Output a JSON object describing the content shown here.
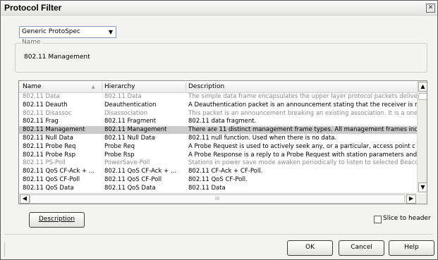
{
  "window": {
    "title": "Protocol Filter"
  },
  "protospec": {
    "selected": "Generic ProtoSpec"
  },
  "name_group": {
    "legend": "Name",
    "value": "802.11 Management"
  },
  "table": {
    "columns": [
      "Name",
      "Hierarchy",
      "Description"
    ],
    "rows": [
      {
        "name": "802.11 Data",
        "hierarchy": "802.11 Data",
        "description": "The simple data frame encapsulates the upper layer protocol packets delivere",
        "dim": true
      },
      {
        "name": "802.11 Deauth",
        "hierarchy": "Deauthentication",
        "description": "A Deauthentication packet is an announcement stating that the receiver is n",
        "dim": false
      },
      {
        "name": "802.11 Disassoc",
        "hierarchy": "Disassociation",
        "description": "This packet is an announcement breaking an existing association. It is a one",
        "dim": true
      },
      {
        "name": "802.11 Frag",
        "hierarchy": "802.11 Fragment",
        "description": "802.11 data fragment.",
        "dim": false
      },
      {
        "name": "802.11 Management",
        "hierarchy": "802.11 Management",
        "description": "There are 11 distinct management frame types. All management frames incl",
        "dim": false,
        "selected": true
      },
      {
        "name": "802.11 Null Data",
        "hierarchy": "802.11 Null Data",
        "description": "802.11 null function. Used when there is no data.",
        "dim": false
      },
      {
        "name": "802.11 Probe Req",
        "hierarchy": "Probe Req",
        "description": "A Probe Request is used to actively seek any, or a particular, access point c",
        "dim": false
      },
      {
        "name": "802.11 Probe Rsp",
        "hierarchy": "Probe Rsp",
        "description": "A Probe Response is a reply to a Probe Request with station parameters and",
        "dim": false
      },
      {
        "name": "802.11 PS-Poll",
        "hierarchy": "PowerSave-Poll",
        "description": "Stations in power save mode awaken periodically to listen to selected Beaco",
        "dim": true
      },
      {
        "name": "802.11 QoS CF-Ack + ...",
        "hierarchy": "802.11 QoS CF-Ack + ...",
        "description": "802.11 CF-Ack + CF-Poll.",
        "dim": false
      },
      {
        "name": "802.11 QoS CF-Poll",
        "hierarchy": "802.11 QoS CF-Poll",
        "description": "802.11 QoS CF-Poll.",
        "dim": false
      },
      {
        "name": "802.11 QoS Data",
        "hierarchy": "802.11 QoS Data",
        "description": "802.11 Data",
        "dim": false
      }
    ],
    "hscroll_grip": "III"
  },
  "buttons": {
    "description_label": "Description",
    "ok_label": "OK",
    "cancel_label": "Cancel",
    "help_label": "Help"
  },
  "slice_checkbox": {
    "label": "Slice to header",
    "checked": false
  },
  "icons": {
    "close": "close-icon",
    "combo_arrow": "chevron-down-icon",
    "scroll_up": "arrow-up-icon",
    "scroll_down": "arrow-down-icon",
    "scroll_left": "arrow-left-icon",
    "scroll_right": "arrow-right-icon"
  },
  "colors": {
    "selected_row": "#cbcbcb",
    "dim_text": "#8a8a8a"
  }
}
